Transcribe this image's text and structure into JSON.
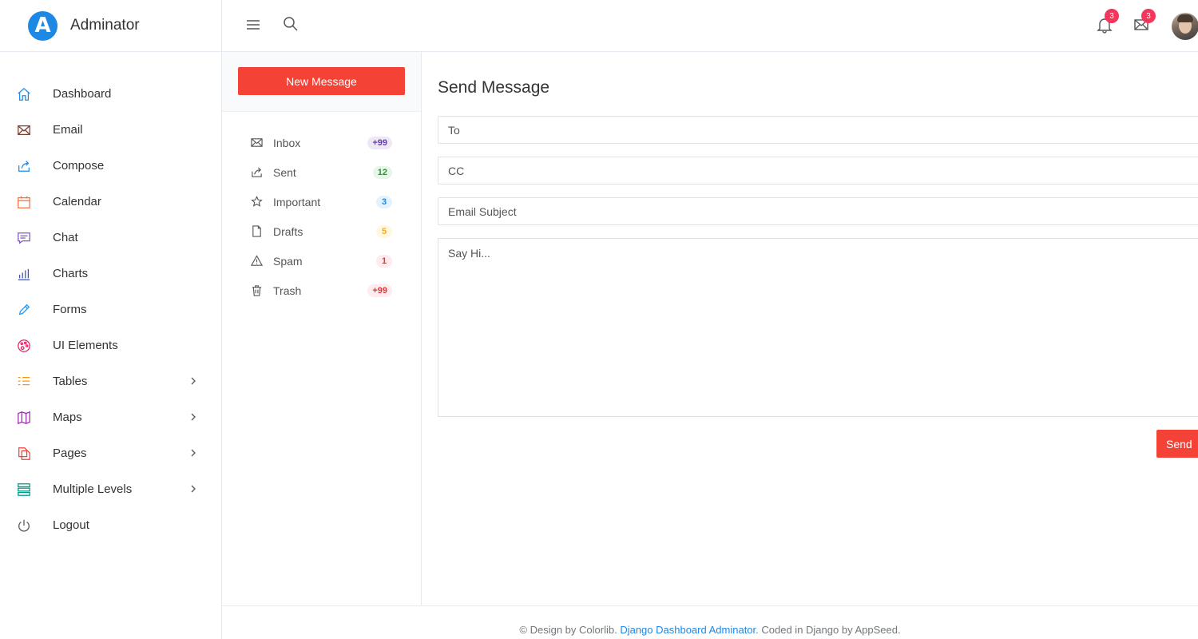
{
  "brand": {
    "name": "Adminator",
    "logo_letter": "A",
    "logo_color": "#1e88e5"
  },
  "sidebar": {
    "items": [
      {
        "label": "Dashboard",
        "icon": "home-icon",
        "color": "#1e88e5",
        "has_submenu": false
      },
      {
        "label": "Email",
        "icon": "mail-icon",
        "color": "#7b3f2f",
        "has_submenu": false
      },
      {
        "label": "Compose",
        "icon": "share-icon",
        "color": "#1e88e5",
        "has_submenu": false
      },
      {
        "label": "Calendar",
        "icon": "calendar-icon",
        "color": "#fb6f3f",
        "has_submenu": false
      },
      {
        "label": "Chat",
        "icon": "chat-icon",
        "color": "#7e57c2",
        "has_submenu": false
      },
      {
        "label": "Charts",
        "icon": "bar-chart-icon",
        "color": "#3f51b5",
        "has_submenu": false
      },
      {
        "label": "Forms",
        "icon": "pencil-icon",
        "color": "#2196f3",
        "has_submenu": false
      },
      {
        "label": "UI Elements",
        "icon": "palette-icon",
        "color": "#e91e63",
        "has_submenu": false
      },
      {
        "label": "Tables",
        "icon": "list-icon",
        "color": "#ff9800",
        "has_submenu": true
      },
      {
        "label": "Maps",
        "icon": "map-icon",
        "color": "#9c27b0",
        "has_submenu": true
      },
      {
        "label": "Pages",
        "icon": "files-icon",
        "color": "#f44336",
        "has_submenu": true
      },
      {
        "label": "Multiple Levels",
        "icon": "layers-icon",
        "color": "#009688",
        "has_submenu": true
      },
      {
        "label": "Logout",
        "icon": "power-icon",
        "color": "#555555",
        "has_submenu": false
      }
    ]
  },
  "topbar": {
    "notifications_count": "3",
    "messages_count": "3",
    "badge_color": "#f5365c"
  },
  "mail": {
    "new_message_label": "New Message",
    "folders": [
      {
        "label": "Inbox",
        "icon": "mail-icon",
        "count": "+99",
        "badge_bg": "#ede7f6",
        "badge_fg": "#673ab7"
      },
      {
        "label": "Sent",
        "icon": "share-icon",
        "count": "12",
        "badge_bg": "#e8f5e9",
        "badge_fg": "#388e3c"
      },
      {
        "label": "Important",
        "icon": "star-icon",
        "count": "3",
        "badge_bg": "#e3f2fd",
        "badge_fg": "#1e88e5"
      },
      {
        "label": "Drafts",
        "icon": "file-icon",
        "count": "5",
        "badge_bg": "#fff8e1",
        "badge_fg": "#f9a825"
      },
      {
        "label": "Spam",
        "icon": "alert-icon",
        "count": "1",
        "badge_bg": "#ffebee",
        "badge_fg": "#e53935"
      },
      {
        "label": "Trash",
        "icon": "trash-icon",
        "count": "+99",
        "badge_bg": "#ffebee",
        "badge_fg": "#e53935"
      }
    ]
  },
  "compose": {
    "title": "Send Message",
    "to_placeholder": "To",
    "cc_placeholder": "CC",
    "subject_placeholder": "Email Subject",
    "body_placeholder": "Say Hi...",
    "send_label": "Send",
    "accent": "#f44336"
  },
  "footer": {
    "prefix": "© Design by Colorlib. ",
    "link_text": "Django Dashboard Adminator",
    "suffix": ". Coded in Django by AppSeed."
  }
}
